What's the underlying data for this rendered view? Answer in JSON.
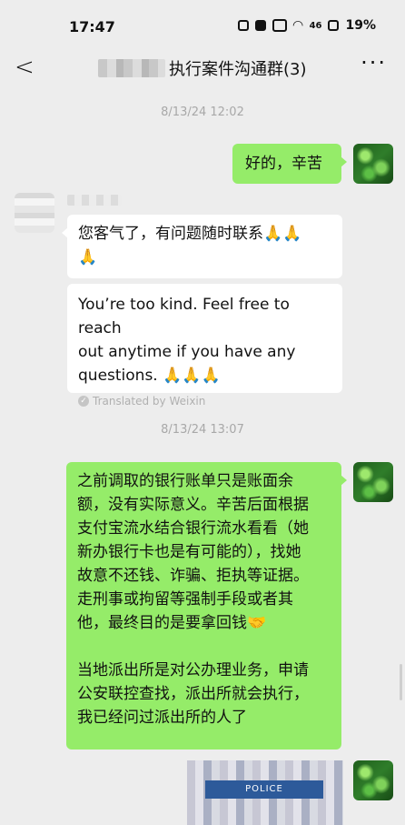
{
  "status_bar": {
    "time": "17:47",
    "signal_text": "46",
    "battery_text": "19%"
  },
  "header": {
    "title_suffix": "执行案件沟通群(3)",
    "back_icon": "back-chevron-icon",
    "more_icon": "more-dots-icon"
  },
  "messages": [
    {
      "type": "timestamp",
      "text": "8/13/24 12:02"
    },
    {
      "type": "outgoing",
      "text": "好的，辛苦"
    },
    {
      "type": "incoming",
      "text": "您客气了，有问题随时联系🙏🙏\n🙏"
    },
    {
      "type": "translation",
      "text": "You’re too kind. Feel free to reach\nout anytime if you have any\nquestions. 🙏🙏🙏",
      "label": "Translated by Weixin"
    },
    {
      "type": "timestamp",
      "text": "8/13/24 13:07"
    },
    {
      "type": "outgoing",
      "text": "之前调取的银行账单只是账面余\n额，没有实际意义。辛苦后面根据\n支付宝流水结合银行流水看看（她\n新办银行卡也是有可能的），找她\n故意不还钱、诈骗、拒执等证据。\n走刑事或拘留等强制手段或者其\n他，最终目的是要拿回钱🤝\n\n当地派出所是对公办理业务，申请\n公安联控查找，派出所就会执行，\n我已经问过派出所的人了"
    },
    {
      "type": "image",
      "caption": "POLICE"
    }
  ]
}
